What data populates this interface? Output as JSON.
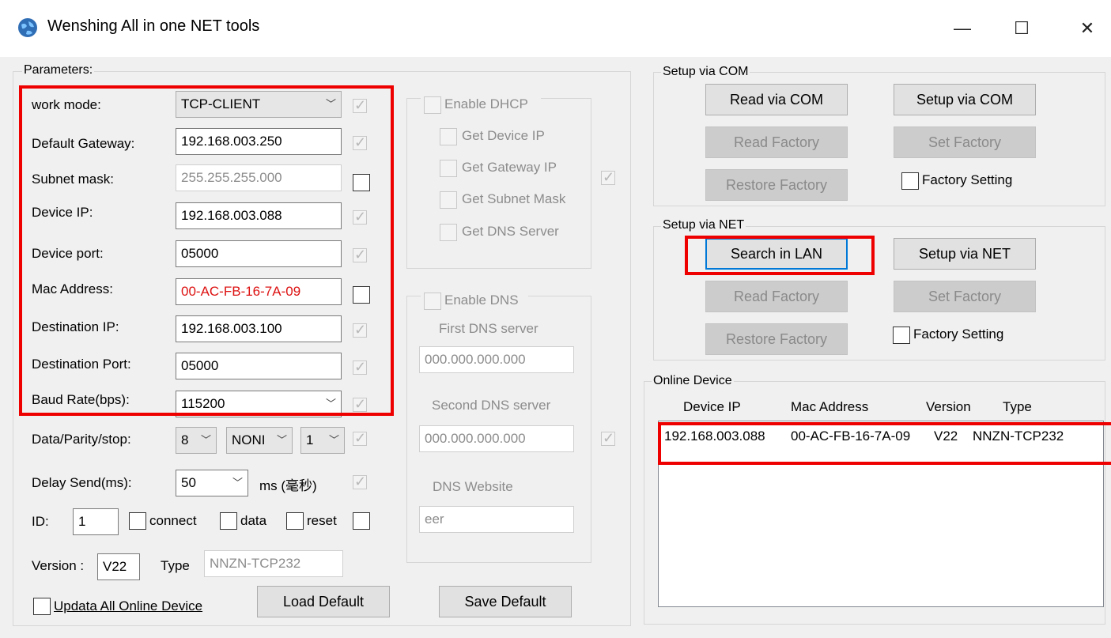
{
  "window": {
    "title": "Wenshing All in one NET tools",
    "minimize": "—",
    "maximize": "☐",
    "close": "✕"
  },
  "params": {
    "legend": "Parameters:",
    "work_mode": {
      "label": "work mode:",
      "value": "TCP-CLIENT"
    },
    "gateway": {
      "label": "Default Gateway:",
      "value": "192.168.003.250"
    },
    "subnet": {
      "label": "Subnet mask:",
      "value": "255.255.255.000"
    },
    "device_ip": {
      "label": "Device IP:",
      "value": "192.168.003.088"
    },
    "device_port": {
      "label": "Device port:",
      "value": "05000"
    },
    "mac": {
      "label": "Mac Address:",
      "value": "00-AC-FB-16-7A-09"
    },
    "dest_ip": {
      "label": "Destination IP:",
      "value": "192.168.003.100"
    },
    "dest_port": {
      "label": "Destination Port:",
      "value": "05000"
    },
    "baud": {
      "label": "Baud Rate(bps):",
      "value": "115200"
    },
    "dps": {
      "label": "Data/Parity/stop:",
      "data": "8",
      "parity": "NONI",
      "stop": "1"
    },
    "delay": {
      "label": "Delay Send(ms):",
      "value": "50",
      "unit": "ms (毫秒)"
    },
    "id": {
      "label": "ID:",
      "value": "1",
      "connect": "connect",
      "data": "data",
      "reset": "reset"
    },
    "version": {
      "label": "Version :",
      "value": "V22",
      "type_label": "Type",
      "type_value": "NNZN-TCP232"
    },
    "update_all": "Updata All Online Device",
    "load_default": "Load Default",
    "save_default": "Save Default"
  },
  "dhcp": {
    "enable": "Enable DHCP",
    "get_ip": "Get Device IP",
    "get_gateway": "Get Gateway IP",
    "get_mask": "Get Subnet Mask",
    "get_dns": "Get DNS Server"
  },
  "dns": {
    "enable": "Enable DNS",
    "first_label": "First DNS server",
    "first_value": "000.000.000.000",
    "second_label": "Second DNS server",
    "second_value": "000.000.000.000",
    "website_label": "DNS Website",
    "website_value": "eer"
  },
  "com": {
    "legend": "Setup via COM",
    "read": "Read via COM",
    "setup": "Setup via COM",
    "read_factory": "Read Factory",
    "set_factory": "Set Factory",
    "restore_factory": "Restore Factory",
    "factory_setting": "Factory Setting"
  },
  "net": {
    "legend": "Setup via NET",
    "search": "Search in LAN",
    "setup": "Setup via NET",
    "read_factory": "Read Factory",
    "set_factory": "Set Factory",
    "restore_factory": "Restore Factory",
    "factory_setting": "Factory Setting"
  },
  "online": {
    "legend": "Online Device",
    "columns": [
      "Device IP",
      "Mac Address",
      "Version",
      "Type"
    ],
    "rows": [
      [
        "192.168.003.088",
        "00-AC-FB-16-7A-09",
        "V22",
        "NNZN-TCP232"
      ]
    ]
  }
}
